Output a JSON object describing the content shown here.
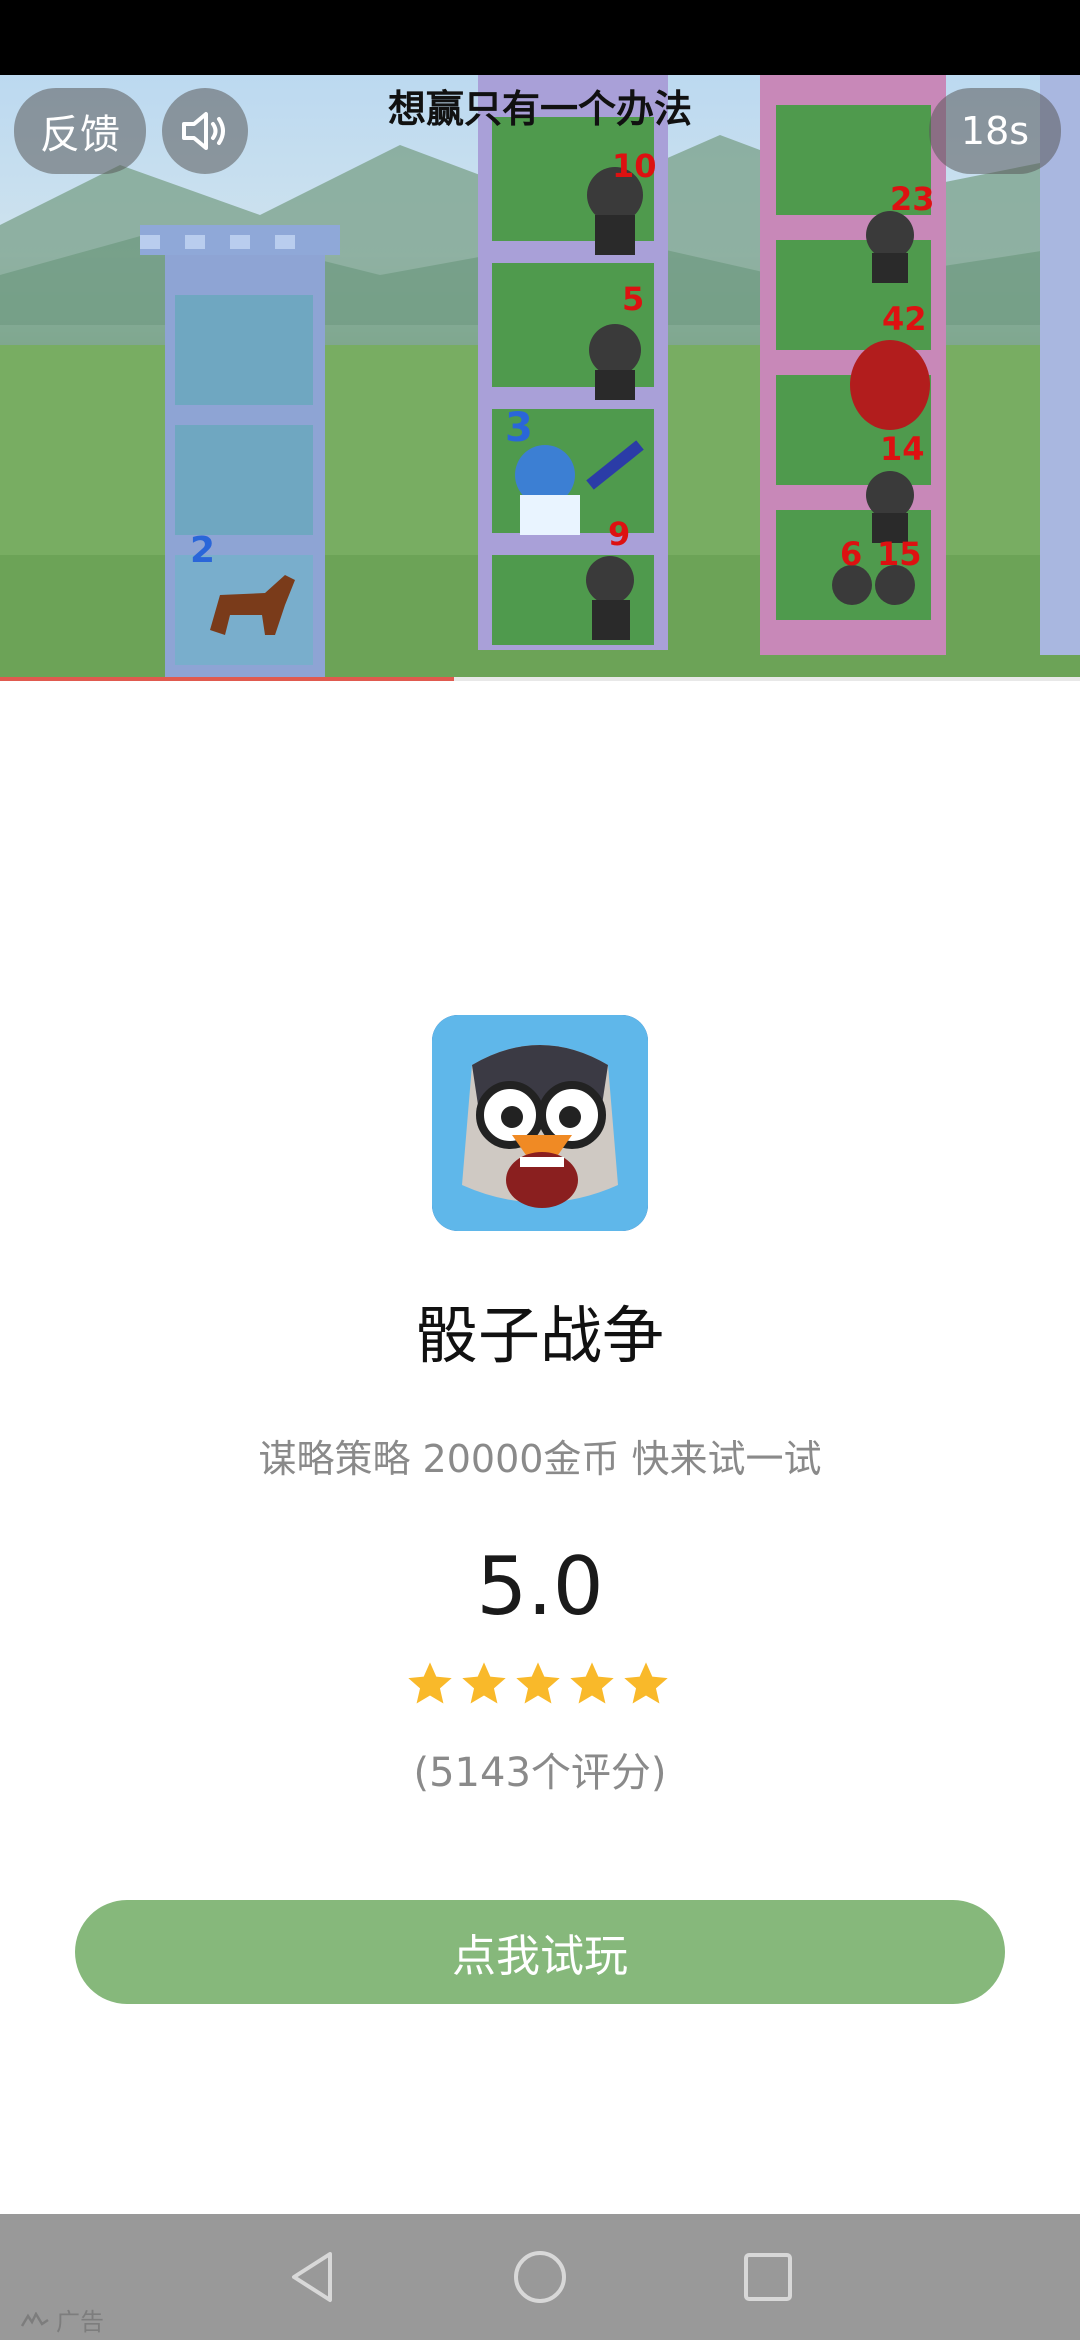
{
  "video": {
    "caption": "想赢只有一个办法",
    "feedback_label": "反馈",
    "sound_icon": "speaker-icon",
    "timer": "18s",
    "progress": 0.42,
    "game_numbers": {
      "hero": "3",
      "horse": "2",
      "tower2": [
        "10",
        "5",
        "9"
      ],
      "tower3": [
        "23",
        "42",
        "14",
        "6",
        "15"
      ]
    }
  },
  "ad": {
    "icon": "game-app-icon",
    "app_name": "骰子战争",
    "description": "谋略策略 20000金币 快来试一试",
    "rating": "5.0",
    "stars": 5,
    "rating_count": "(5143个评分)",
    "cta": "点我试玩"
  },
  "footer": {
    "ad_label": "广告"
  },
  "colors": {
    "cta": "#86b87b",
    "star": "#f9b92a",
    "progress": "#e05a4f",
    "nav_bar": "#999999"
  }
}
